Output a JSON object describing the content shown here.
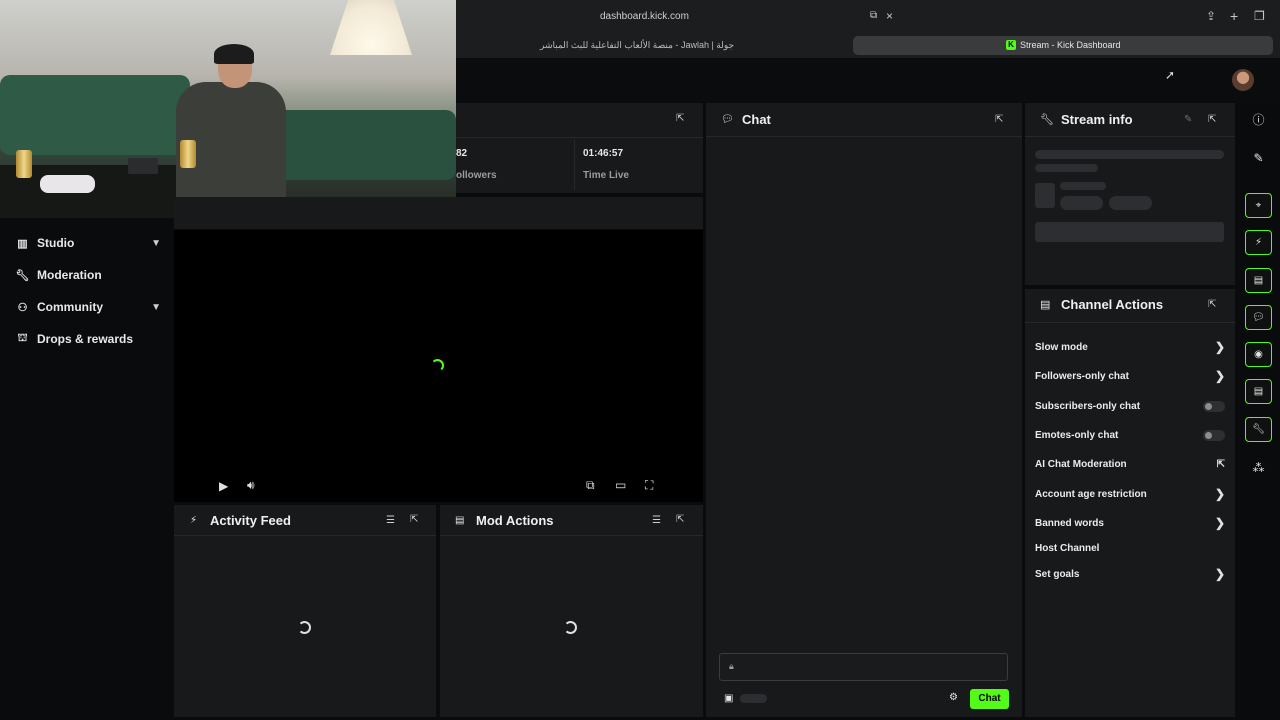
{
  "browser": {
    "url": "dashboard.kick.com",
    "tabs": [
      {
        "label": "جولة | Jawlah - منصة الألعاب التفاعلية للبث المباشر",
        "active": false
      },
      {
        "label": "Stream - Kick Dashboard",
        "active": true
      }
    ],
    "favicon_letter": "K"
  },
  "sidebar": {
    "items": [
      {
        "label": "Studio",
        "icon": "studio-icon",
        "expandable": true
      },
      {
        "label": "Moderation",
        "icon": "wrench-icon",
        "expandable": false
      },
      {
        "label": "Community",
        "icon": "community-icon",
        "expandable": true
      },
      {
        "label": "Drops & rewards",
        "icon": "drops-icon",
        "expandable": false
      }
    ]
  },
  "stats": {
    "followers_value": "82",
    "followers_label": "ollowers",
    "time_live_value": "01:46:57",
    "time_live_label": "Time Live"
  },
  "chat": {
    "title": "Chat",
    "send_label": "Chat"
  },
  "stream_info": {
    "title": "Stream info"
  },
  "channel_actions": {
    "title": "Channel Actions",
    "items": [
      {
        "label": "Slow mode",
        "control": "chevron"
      },
      {
        "label": "Followers-only chat",
        "control": "chevron"
      },
      {
        "label": "Subscribers-only chat",
        "control": "toggle",
        "on": false
      },
      {
        "label": "Emotes-only chat",
        "control": "toggle",
        "on": false
      },
      {
        "label": "AI Chat Moderation",
        "control": "external"
      },
      {
        "label": "Account age restriction",
        "control": "chevron"
      },
      {
        "label": "Banned words",
        "control": "chevron"
      },
      {
        "label": "Host Channel",
        "control": "none"
      },
      {
        "label": "Set goals",
        "control": "chevron"
      }
    ]
  },
  "activity_feed": {
    "title": "Activity Feed"
  },
  "mod_actions": {
    "title": "Mod Actions"
  },
  "colors": {
    "accent": "#53fc18",
    "panel": "#18191b",
    "background": "#0a0b0c"
  }
}
